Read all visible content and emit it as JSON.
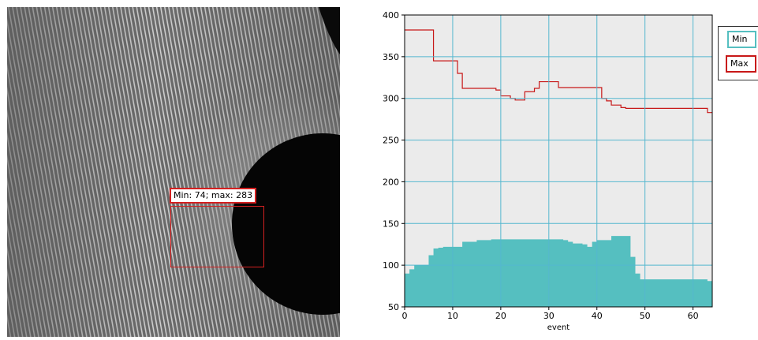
{
  "image_view": {
    "roi_label": "Min: 74; max: 283",
    "roi_color": "#d42020"
  },
  "legend": {
    "min_label": "Min",
    "max_label": "Max",
    "min_color": "#55bfc0",
    "max_color": "#c81818"
  },
  "chart_data": {
    "type": "area",
    "xlabel": "event",
    "ylabel": "",
    "xlim": [
      0,
      64
    ],
    "ylim": [
      50,
      400
    ],
    "xticks": [
      0,
      10,
      20,
      30,
      40,
      50,
      60
    ],
    "yticks": [
      50,
      100,
      150,
      200,
      250,
      300,
      350,
      400
    ],
    "grid": true,
    "legend_position": "right",
    "series": [
      {
        "name": "Min",
        "color": "#55bfc0",
        "steps": [
          [
            0,
            90
          ],
          [
            1,
            95
          ],
          [
            2,
            100
          ],
          [
            5,
            112
          ],
          [
            6,
            120
          ],
          [
            7,
            121
          ],
          [
            8,
            122
          ],
          [
            12,
            128
          ],
          [
            15,
            130
          ],
          [
            18,
            131
          ],
          [
            33,
            130
          ],
          [
            34,
            128
          ],
          [
            35,
            126
          ],
          [
            37,
            125
          ],
          [
            38,
            122
          ],
          [
            39,
            128
          ],
          [
            40,
            130
          ],
          [
            43,
            135
          ],
          [
            47,
            110
          ],
          [
            48,
            90
          ],
          [
            49,
            83
          ],
          [
            63,
            81
          ],
          [
            64,
            72
          ]
        ]
      },
      {
        "name": "Max",
        "color": "#c81818",
        "steps": [
          [
            0,
            382
          ],
          [
            5,
            382
          ],
          [
            6,
            345
          ],
          [
            10,
            345
          ],
          [
            11,
            330
          ],
          [
            12,
            312
          ],
          [
            18,
            312
          ],
          [
            19,
            310
          ],
          [
            20,
            303
          ],
          [
            22,
            300
          ],
          [
            23,
            298
          ],
          [
            24,
            298
          ],
          [
            25,
            308
          ],
          [
            27,
            312
          ],
          [
            28,
            320
          ],
          [
            31,
            320
          ],
          [
            32,
            313
          ],
          [
            40,
            313
          ],
          [
            41,
            300
          ],
          [
            42,
            297
          ],
          [
            43,
            292
          ],
          [
            45,
            289
          ],
          [
            46,
            288
          ],
          [
            62,
            288
          ],
          [
            63,
            283
          ],
          [
            64,
            283
          ]
        ]
      }
    ]
  }
}
